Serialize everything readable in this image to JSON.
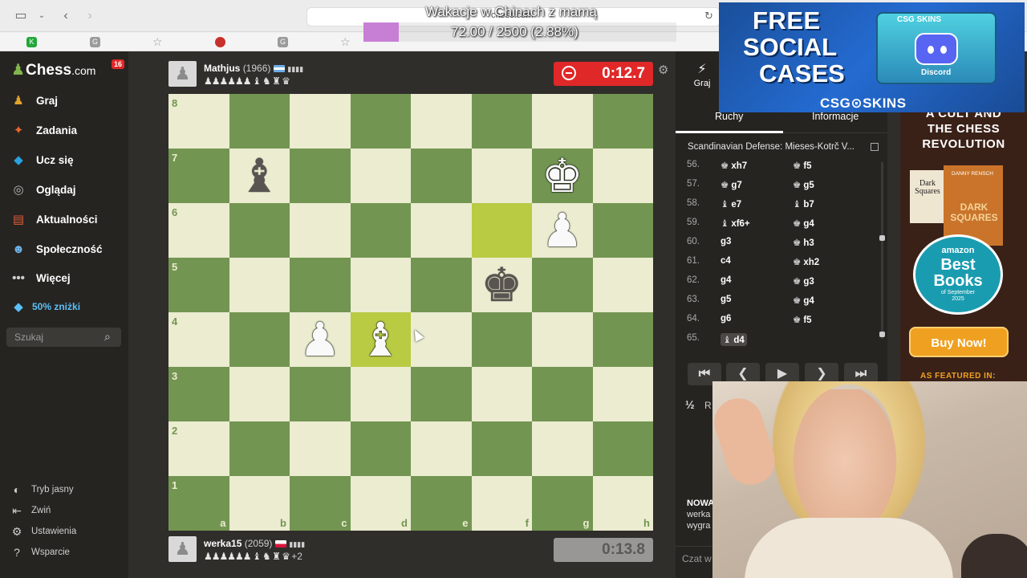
{
  "overlay": {
    "title": "Wakacje w Chinach z mamą",
    "progress_text": "72.00 / 2500 (2.88%)",
    "progress_fraction": 0.0288
  },
  "browser": {
    "url": "chess.com"
  },
  "sidebar": {
    "logo": "Chess",
    "logo_suffix": ".com",
    "notification_count": "16",
    "items": [
      {
        "label": "Graj",
        "icon": "play-icon",
        "color": "#e2a32c"
      },
      {
        "label": "Zadania",
        "icon": "puzzle-icon",
        "color": "#e8672b"
      },
      {
        "label": "Ucz się",
        "icon": "learn-icon",
        "color": "#2aa1e0"
      },
      {
        "label": "Oglądaj",
        "icon": "binoculars-icon",
        "color": "#b7b7b7"
      },
      {
        "label": "Aktualności",
        "icon": "news-icon",
        "color": "#e05b3a"
      },
      {
        "label": "Społeczność",
        "icon": "community-icon",
        "color": "#6fb2e8"
      },
      {
        "label": "Więcej",
        "icon": "more-icon",
        "color": "#cfcfcf"
      }
    ],
    "promo": "50% zniżki",
    "search_placeholder": "Szukaj",
    "bottom": [
      {
        "label": "Tryb jasny",
        "icon": "theme-icon"
      },
      {
        "label": "Zwiń",
        "icon": "collapse-icon"
      },
      {
        "label": "Ustawienia",
        "icon": "settings-icon"
      },
      {
        "label": "Wsparcie",
        "icon": "help-icon"
      }
    ]
  },
  "top_player": {
    "name": "Mathjus",
    "rating": "(1966)",
    "captured": "♟♟♟♟♟♟ ♝ ♞ ♜ ♛",
    "clock": "0:12.7"
  },
  "bottom_player": {
    "name": "werka15",
    "rating": "(2059)",
    "captured": "♟♟♟♟♟♟ ♝ ♞ ♜ ♛",
    "extra": "+2",
    "clock": "0:13.8"
  },
  "board": {
    "files": [
      "a",
      "b",
      "c",
      "d",
      "e",
      "f",
      "g",
      "h"
    ],
    "ranks": [
      "8",
      "7",
      "6",
      "5",
      "4",
      "3",
      "2",
      "1"
    ],
    "highlights": [
      "f6",
      "d4"
    ],
    "pieces": [
      {
        "sq": "b7",
        "glyph": "♝",
        "color": "b",
        "name": "black-bishop"
      },
      {
        "sq": "g7",
        "glyph": "♚",
        "color": "w",
        "name": "white-king"
      },
      {
        "sq": "g6",
        "glyph": "♟",
        "color": "w",
        "name": "white-pawn"
      },
      {
        "sq": "f5",
        "glyph": "♚",
        "color": "b",
        "name": "black-king"
      },
      {
        "sq": "c4",
        "glyph": "♟",
        "color": "w",
        "name": "white-pawn"
      },
      {
        "sq": "d4",
        "glyph": "♝",
        "color": "w",
        "name": "white-bishop"
      }
    ]
  },
  "right_panel": {
    "play_tab": "Graj",
    "tabs": [
      "Ruchy",
      "Informacje"
    ],
    "opening": "Scandinavian Defense: Mieses-Kotrč V...",
    "moves": [
      {
        "num": "56.",
        "w": "xh7",
        "wp": "♚",
        "b": "f5",
        "bp": "♚"
      },
      {
        "num": "57.",
        "w": "g7",
        "wp": "♚",
        "b": "g5",
        "bp": "♚"
      },
      {
        "num": "58.",
        "w": "e7",
        "wp": "♝",
        "b": "b7",
        "bp": "♝"
      },
      {
        "num": "59.",
        "w": "xf6+",
        "wp": "♝",
        "b": "g4",
        "bp": "♚"
      },
      {
        "num": "60.",
        "w": "g3",
        "wp": "",
        "b": "h3",
        "bp": "♚"
      },
      {
        "num": "61.",
        "w": "c4",
        "wp": "",
        "b": "xh2",
        "bp": "♚"
      },
      {
        "num": "62.",
        "w": "g4",
        "wp": "",
        "b": "g3",
        "bp": "♚"
      },
      {
        "num": "63.",
        "w": "g5",
        "wp": "",
        "b": "g4",
        "bp": "♚"
      },
      {
        "num": "64.",
        "w": "g6",
        "wp": "",
        "b": "f5",
        "bp": "♚"
      },
      {
        "num": "65.",
        "w": "d4",
        "wp": "♝",
        "b": "",
        "bp": ""
      }
    ],
    "controls": [
      "⏮",
      "❮",
      "▶",
      "❯",
      "⏭"
    ],
    "half_icon": "½",
    "half_text": "R",
    "news_line1": "NOWA",
    "news_line2": "werka",
    "news_line3": "wygra",
    "chat_placeholder": "Czat w"
  },
  "ads": {
    "csg_line1": "FREE",
    "csg_line2": "SOCIAL",
    "csg_line3": "CASES",
    "csg_brand": "CSG⊙SKINS",
    "csg_case_label": "CSG SKINS",
    "csg_discord": "Discord",
    "book_top1": "A CULT AND",
    "book_top2": "THE CHESS",
    "book_top3": "REVOLUTION",
    "book1_title": "Dark Squares",
    "book2_author": "DANNY RENSCH",
    "book2_title": "DARK SQUARES",
    "amazon": "amazon",
    "best": "Best",
    "books": "Books",
    "of_sept": "of September",
    "year": "2025",
    "buy": "Buy Now!",
    "featured": "AS FEATURED IN:"
  },
  "colors": {
    "light_square": "#ebecd0",
    "dark_square": "#739552",
    "highlight_dark": "#b9ca43",
    "clock_active": "#e02828"
  }
}
